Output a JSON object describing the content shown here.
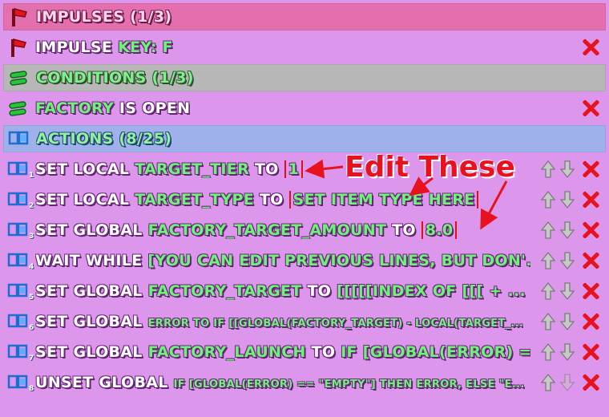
{
  "impulses_header": "IMPULSES (1/3)",
  "impulse": {
    "label": "IMPULSE",
    "key_label": "KEY: F"
  },
  "conditions_header": "CONDITIONS (1/3)",
  "condition": {
    "var": "FACTORY",
    "rest": " IS OPEN"
  },
  "actions_header": "ACTIONS (8/25)",
  "actions": [
    {
      "n": "1",
      "a": "SET LOCAL ",
      "b": "TARGET_TIER",
      "c": " TO ",
      "d": "1"
    },
    {
      "n": "2",
      "a": "SET LOCAL ",
      "b": "TARGET_TYPE",
      "c": " TO ",
      "d": "SET ITEM TYPE HERE"
    },
    {
      "n": "3",
      "a": "SET GLOBAL ",
      "b": "FACTORY_TARGET_AMOUNT",
      "c": " TO ",
      "d": "8.0"
    },
    {
      "n": "4",
      "a": "WAIT WHILE ",
      "b": "[YOU CAN EDIT PREVIOUS LINES, BUT DON'...",
      "c": "",
      "d": ""
    },
    {
      "n": "5",
      "a": "SET GLOBAL ",
      "b": "FACTORY_TARGET",
      "c": " TO ",
      "d": "[[[[[INDEX OF [[[ + ..."
    },
    {
      "n": "6",
      "a": "SET GLOBAL ",
      "b": "ERROR TO IF [[GLOBAL(FACTORY_TARGET) - LOCAL(TARGET_...",
      "c": "",
      "d": ""
    },
    {
      "n": "7",
      "a": "SET GLOBAL ",
      "b": "FACTORY_LAUNCH",
      "c": " TO ",
      "d": "IF [GLOBAL(ERROR) ==..."
    },
    {
      "n": "8",
      "a": "UNSET GLOBAL ",
      "b": "IF [GLOBAL(ERROR) == \"EMPTY\"] THEN ERROR, ELSE \"E...",
      "c": "",
      "d": ""
    }
  ],
  "annotation": "Edit These",
  "colors": {
    "accent_green": "#6ff27a",
    "delete_red": "#e8121e",
    "annotation_red": "#e8121e"
  },
  "icons": {
    "impulse": "red-flag-icon",
    "condition": "green-equals-icon",
    "action": "blue-action-icon",
    "delete": "close-x-icon",
    "move_up": "arrow-up-icon",
    "move_down": "arrow-down-icon"
  }
}
